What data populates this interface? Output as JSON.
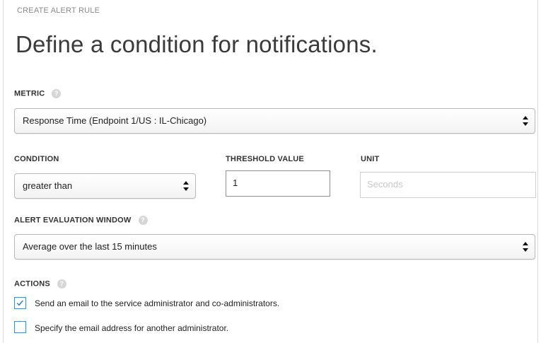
{
  "header": {
    "eyebrow": "CREATE ALERT RULE",
    "title": "Define a condition for notifications."
  },
  "metric": {
    "label": "METRIC",
    "value": "Response Time (Endpoint 1/US : IL-Chicago)"
  },
  "condition": {
    "label": "CONDITION",
    "value": "greater than"
  },
  "threshold": {
    "label": "THRESHOLD VALUE",
    "value": "1"
  },
  "unit": {
    "label": "UNIT",
    "placeholder": "Seconds"
  },
  "window": {
    "label": "ALERT EVALUATION WINDOW",
    "value": "Average over the last 15 minutes"
  },
  "actions": {
    "label": "ACTIONS",
    "items": [
      {
        "label": "Send an email to the service administrator and co-administrators.",
        "checked": true
      },
      {
        "label": "Specify the email address for another administrator.",
        "checked": false
      }
    ]
  },
  "icons": {
    "help": "help-icon",
    "checkmark": "checkmark-icon",
    "select-arrows": "updown-arrows-icon"
  },
  "colors": {
    "accent": "#4a8fc4",
    "label": "#333333",
    "muted": "#8a8a8a"
  }
}
